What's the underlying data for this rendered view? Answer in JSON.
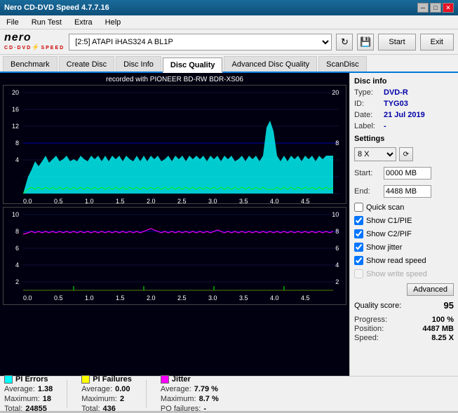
{
  "titleBar": {
    "title": "Nero CD-DVD Speed 4.7.7.16",
    "controls": [
      "minimize",
      "maximize",
      "close"
    ]
  },
  "menuBar": {
    "items": [
      "File",
      "Run Test",
      "Extra",
      "Help"
    ]
  },
  "header": {
    "driveValue": "[2:5]  ATAPI iHAS324  A BL1P",
    "startBtn": "Start",
    "exitBtn": "Exit"
  },
  "tabs": [
    {
      "label": "Benchmark",
      "active": false
    },
    {
      "label": "Create Disc",
      "active": false
    },
    {
      "label": "Disc Info",
      "active": false
    },
    {
      "label": "Disc Quality",
      "active": true
    },
    {
      "label": "Advanced Disc Quality",
      "active": false
    },
    {
      "label": "ScanDisc",
      "active": false
    }
  ],
  "chart": {
    "title": "recorded with PIONEER  BD-RW   BDR-XS06",
    "topYMax": 20,
    "topYMid": 8,
    "bottomYMax": 10,
    "xLabels": [
      "0.0",
      "0.5",
      "1.0",
      "1.5",
      "2.0",
      "2.5",
      "3.0",
      "3.5",
      "4.0",
      "4.5"
    ]
  },
  "discInfo": {
    "sectionLabel": "Disc info",
    "type": {
      "label": "Type:",
      "value": "DVD-R"
    },
    "id": {
      "label": "ID:",
      "value": "TYG03"
    },
    "date": {
      "label": "Date:",
      "value": "21 Jul 2019"
    },
    "label": {
      "label": "Label:",
      "value": "-"
    }
  },
  "settings": {
    "sectionLabel": "Settings",
    "speed": "8 X",
    "start": {
      "label": "Start:",
      "value": "0000 MB"
    },
    "end": {
      "label": "End:",
      "value": "4488 MB"
    },
    "checkboxes": [
      {
        "label": "Quick scan",
        "checked": false
      },
      {
        "label": "Show C1/PIE",
        "checked": true
      },
      {
        "label": "Show C2/PIF",
        "checked": true
      },
      {
        "label": "Show jitter",
        "checked": true
      },
      {
        "label": "Show read speed",
        "checked": true
      },
      {
        "label": "Show write speed",
        "checked": false,
        "disabled": true
      }
    ],
    "advancedBtn": "Advanced"
  },
  "qualityScore": {
    "label": "Quality score:",
    "value": "95"
  },
  "progress": {
    "items": [
      {
        "label": "Progress:",
        "value": "100 %"
      },
      {
        "label": "Position:",
        "value": "4487 MB"
      },
      {
        "label": "Speed:",
        "value": "8.25 X"
      }
    ]
  },
  "statsBar": {
    "piErrors": {
      "colorHex": "#00ffff",
      "label": "PI Errors",
      "average": {
        "label": "Average:",
        "value": "1.38"
      },
      "maximum": {
        "label": "Maximum:",
        "value": "18"
      },
      "total": {
        "label": "Total:",
        "value": "24855"
      }
    },
    "piFailures": {
      "colorHex": "#ffff00",
      "label": "PI Failures",
      "average": {
        "label": "Average:",
        "value": "0.00"
      },
      "maximum": {
        "label": "Maximum:",
        "value": "2"
      },
      "total": {
        "label": "Total:",
        "value": "436"
      }
    },
    "jitter": {
      "colorHex": "#ff00ff",
      "label": "Jitter",
      "average": {
        "label": "Average:",
        "value": "7.79 %"
      },
      "maximum": {
        "label": "Maximum:",
        "value": "8.7 %"
      },
      "po": {
        "label": "PO failures:",
        "value": "-"
      }
    }
  }
}
